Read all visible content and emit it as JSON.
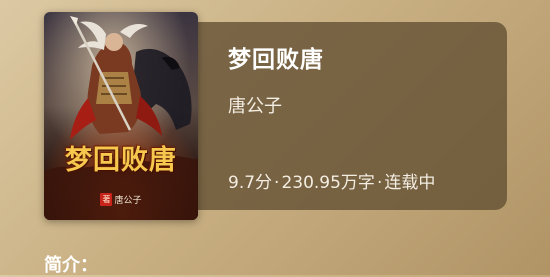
{
  "book": {
    "title": "梦回败唐",
    "author": "唐公子",
    "rating": "9.7分",
    "word_count": "230.95万字",
    "status": "连载中",
    "separator": "·"
  },
  "cover": {
    "title": "梦回败唐",
    "seal_char": "著",
    "author": "唐公子"
  },
  "intro": {
    "label": "简介："
  },
  "colors": {
    "card_background": "#624e32",
    "page_background": "#c9b083",
    "cover_title": "#f6c94e"
  }
}
